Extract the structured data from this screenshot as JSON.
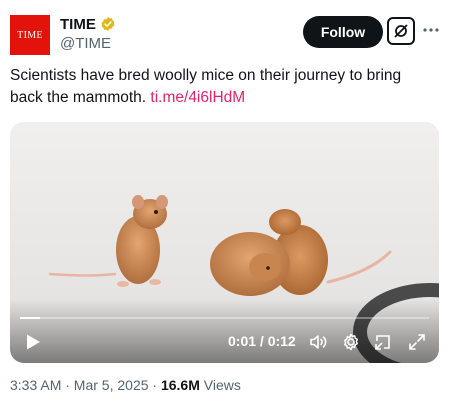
{
  "author": {
    "avatar_text": "TIME",
    "display_name": "TIME",
    "handle": "@TIME",
    "verified_badge": "gold-checkmark-icon",
    "brand_color": "#e3120b"
  },
  "actions": {
    "follow_label": "Follow",
    "grok_icon": "grok-icon",
    "more_icon": "more-dots-icon"
  },
  "tweet": {
    "text": "Scientists have bred woolly mice on their journey to bring back the mammoth. ",
    "link_text": "ti.me/4i6lHdM",
    "link_color": "#e2246e"
  },
  "video": {
    "time_display": "0:01 / 0:12",
    "progress_fraction": 0.05,
    "icons": [
      "play-icon",
      "volume-icon",
      "settings-gear-icon",
      "picture-in-picture-icon",
      "fullscreen-icon"
    ]
  },
  "meta": {
    "timestamp": "3:33 AM · Mar 5, 2025 · ",
    "views_count": "16.6M",
    "views_label": " Views"
  }
}
